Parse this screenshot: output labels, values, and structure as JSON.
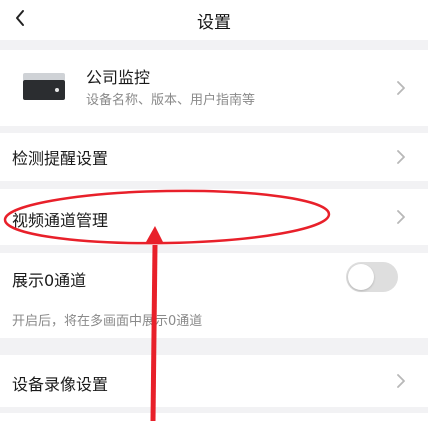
{
  "nav": {
    "title": "设置"
  },
  "device": {
    "name": "公司监控",
    "subtitle": "设备名称、版本、用户指南等"
  },
  "rows": {
    "alert_settings": "检测提醒设置",
    "channel_manage": "视频通道管理",
    "show_zero_channel": "展示0通道",
    "show_zero_hint": "开启后，将在多画面中展示0通道",
    "record_settings": "设备录像设置"
  },
  "toggle_show_zero_on": false,
  "annotation_color": "#e8202a"
}
